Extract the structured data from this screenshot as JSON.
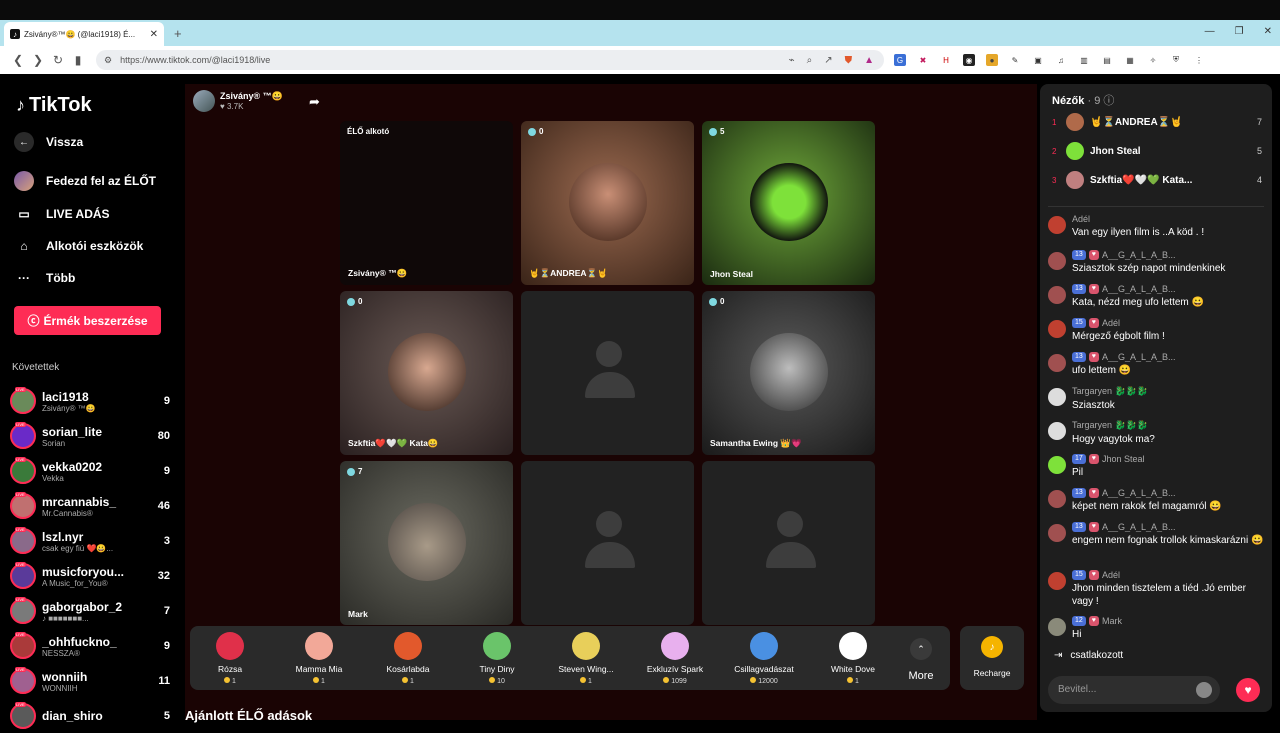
{
  "browser": {
    "tab_title": "Zsivány®™😀 (@laci1918) É...",
    "url": "https://www.tiktok.com/@laci1918/live",
    "new_tab": "+"
  },
  "sidebar": {
    "logo": "TikTok",
    "back": "Vissza",
    "nav": [
      {
        "label": "Fedezd fel az ÉLŐT"
      },
      {
        "label": "LIVE ADÁS"
      },
      {
        "label": "Alkotói eszközök"
      },
      {
        "label": "Több"
      }
    ],
    "coins_button": "Érmék beszerzése",
    "following_header": "Követettek",
    "following": [
      {
        "name": "laci1918",
        "sub": "Zsivány® ™😀",
        "count": "9"
      },
      {
        "name": "sorian_lite",
        "sub": "Sorian",
        "count": "80"
      },
      {
        "name": "vekka0202",
        "sub": "Vekka",
        "count": "9"
      },
      {
        "name": "mrcannabis_",
        "sub": "Mr.Cannabis®",
        "count": "46"
      },
      {
        "name": "lszl.nyr",
        "sub": "csak egy fiú ❤️😀...",
        "count": "3"
      },
      {
        "name": "musicforyou...",
        "sub": "A Music_for_You®",
        "count": "32"
      },
      {
        "name": "gaborgabor_2",
        "sub": "♪ ■■■■■■■...",
        "count": "7"
      },
      {
        "name": "_ohhfuckno_",
        "sub": "NESSZA®",
        "count": "9"
      },
      {
        "name": "wonniih",
        "sub": "WONNIIH",
        "count": "11"
      },
      {
        "name": "dian_shiro",
        "sub": "",
        "count": "5"
      }
    ],
    "live_tag": "LIVE"
  },
  "stage": {
    "host_name": "Zsivány® ™😀",
    "host_likes": "♥ 3.7K",
    "cells": [
      {
        "badge": "ÉLŐ alkotó",
        "name": "Zsivány® ™😀"
      },
      {
        "badge": "0",
        "name": "🤘⏳ANDREA⏳🤘"
      },
      {
        "badge": "5",
        "name": "Jhon Steal"
      },
      {
        "badge": "0",
        "name": "Szkftia❤️🤍💚 Kata😀"
      },
      {
        "badge": "",
        "name": ""
      },
      {
        "badge": "0",
        "name": "Samantha Ewing 👑💗"
      },
      {
        "badge": "7",
        "name": "Mark"
      },
      {
        "badge": "",
        "name": ""
      },
      {
        "badge": "",
        "name": ""
      }
    ]
  },
  "gifts": [
    {
      "name": "Rózsa",
      "price": "1",
      "color": "#e0304a"
    },
    {
      "name": "Mamma Mia",
      "price": "1",
      "color": "#f2a898"
    },
    {
      "name": "Kosárlabda",
      "price": "1",
      "color": "#e2592c"
    },
    {
      "name": "Tiny Diny",
      "price": "10",
      "color": "#6ac46a"
    },
    {
      "name": "Steven Wing...",
      "price": "1",
      "color": "#e8cf5a"
    },
    {
      "name": "Exkluzív Spark",
      "price": "1099",
      "color": "#e8b0ee"
    },
    {
      "name": "Csillagvadászat",
      "price": "12000",
      "color": "#4a90e2"
    },
    {
      "name": "White Dove",
      "price": "1",
      "color": "#ffffff"
    }
  ],
  "more_label": "More",
  "recharge_label": "Recharge",
  "recommended_header": "Ajánlott ÉLŐ adások",
  "panel": {
    "title": "Nézők",
    "count": "· 9",
    "viewers": [
      {
        "rank": "1",
        "name": "🤘⏳ANDREA⏳🤘",
        "score": "7"
      },
      {
        "rank": "2",
        "name": "Jhon Steal",
        "score": "5"
      },
      {
        "rank": "3",
        "name": "Szkftia❤️🤍💚 Kata...",
        "score": "4"
      }
    ],
    "messages": [
      {
        "head": "Adél",
        "text": "Van egy ilyen film is ..A köd . !"
      },
      {
        "head": "A__G_A_L_A_B...",
        "lv": "13",
        "text": "Sziasztok szép napot mindenkinek"
      },
      {
        "head": "A__G_A_L_A_B...",
        "lv": "13",
        "text": "Kata, nézd meg ufo lettem 😀"
      },
      {
        "head": "Adél",
        "lv": "15",
        "text": "Mérgező égbolt film !"
      },
      {
        "head": "A__G_A_L_A_B...",
        "lv": "13",
        "text": "ufo lettem 😀"
      },
      {
        "head": "Targaryen 🐉🐉🐉",
        "lv": "",
        "text": "Sziasztok"
      },
      {
        "head": "Targaryen 🐉🐉🐉",
        "lv": "",
        "text": "Hogy vagytok ma?"
      },
      {
        "head": "Jhon Steal",
        "lv": "17",
        "text": "Pil"
      },
      {
        "head": "A__G_A_L_A_B...",
        "lv": "13",
        "text": "képet nem rakok fel magamról 😀"
      },
      {
        "head": "A__G_A_L_A_B...",
        "lv": "13",
        "text": "engem nem fognak trollok kimaskarázni 😀"
      },
      {
        "head": "Adél",
        "lv": "15",
        "text": "Jhon minden tisztelem a tiéd .Jó ember vagy !"
      },
      {
        "head": "Mark",
        "lv": "12",
        "text": "Hi"
      }
    ],
    "joined_text": "csatlakozott",
    "input_placeholder": "Bevitel..."
  }
}
